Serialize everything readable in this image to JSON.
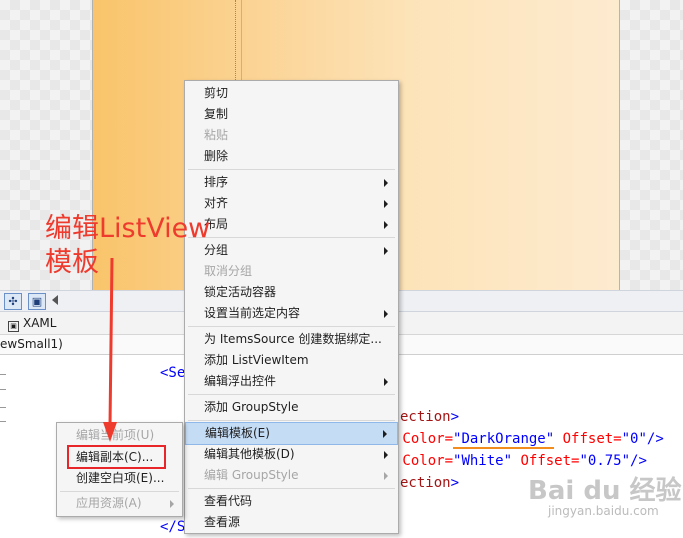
{
  "toolbar": {
    "btn1_glyph": "✣",
    "btn2_glyph": "▣"
  },
  "tabs": {
    "xaml": "XAML",
    "xaml_icon": "▣"
  },
  "nav": {
    "text": "ewSmall1)"
  },
  "code": {
    "line1_tag": "<Se",
    "line2_a": "ection",
    "line2_b": ">",
    "line3_attr1": " Color=",
    "line3_val1": "\"DarkOrange\"",
    "line3_attr2": " Offset=",
    "line3_val2": "\"0\"",
    "line3_rest": "/>",
    "line4_attr1": " Color=",
    "line4_val1": "\"White\"",
    "line4_attr2": " Offset=",
    "line4_val2": "\"0.75\"",
    "line4_rest": "/>",
    "line5_a": "ection",
    "line5_b": ">",
    "line6": "</S"
  },
  "context_menu": {
    "items": [
      {
        "label": "剪切"
      },
      {
        "label": "复制"
      },
      {
        "label": "粘贴"
      },
      {
        "label": "删除"
      },
      {
        "label": "排序"
      },
      {
        "label": "对齐"
      },
      {
        "label": "布局"
      },
      {
        "label": "分组"
      },
      {
        "label": "取消分组"
      },
      {
        "label": "锁定活动容器"
      },
      {
        "label": "设置当前选定内容"
      },
      {
        "label": "为 ItemsSource 创建数据绑定..."
      },
      {
        "label": "添加 ListViewItem"
      },
      {
        "label": "编辑浮出控件"
      },
      {
        "label": "添加 GroupStyle"
      },
      {
        "label": "编辑模板(E)"
      },
      {
        "label": "编辑其他模板(D)"
      },
      {
        "label": "编辑 GroupStyle"
      },
      {
        "label": "查看代码"
      },
      {
        "label": "查看源"
      }
    ]
  },
  "sub_menu": {
    "items": [
      {
        "label": "编辑当前项(U)"
      },
      {
        "label": "编辑副本(C)..."
      },
      {
        "label": "创建空白项(E)..."
      },
      {
        "label": "应用资源(A)"
      }
    ]
  },
  "annotation": {
    "text": "编辑ListView\n模板"
  },
  "watermark": {
    "main": "Bai du 经验",
    "sub": "jingyan.baidu.com"
  },
  "colors": {
    "annotation": "#ee3b2e",
    "highlight": "#c5dcf5",
    "redbox": "#e8262a"
  }
}
